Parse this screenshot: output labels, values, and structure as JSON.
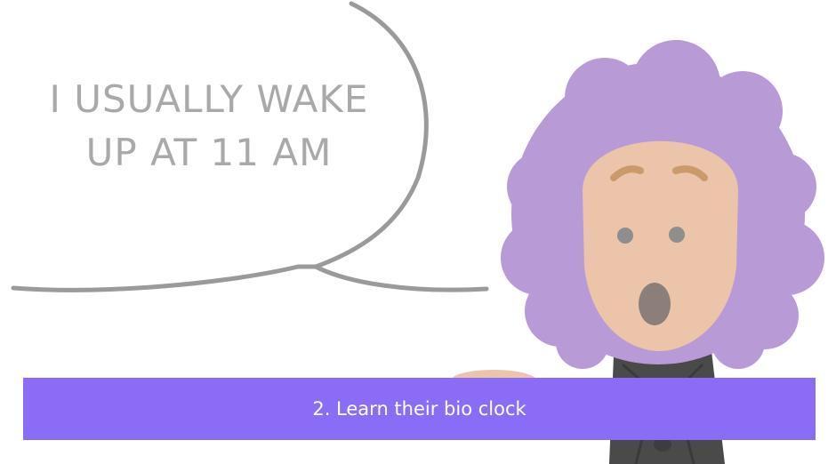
{
  "speech_bubble": {
    "line1": "I USUALLY WAKE",
    "line2": "UP AT 11 AM"
  },
  "caption": {
    "label": "2. Learn their bio clock"
  },
  "colors": {
    "banner": "#8b6cf7",
    "hair": "#b89ad6",
    "skin": "#ecc4aa",
    "bubble_outline": "#9e9e9e",
    "jacket": "#4a4a4a"
  }
}
